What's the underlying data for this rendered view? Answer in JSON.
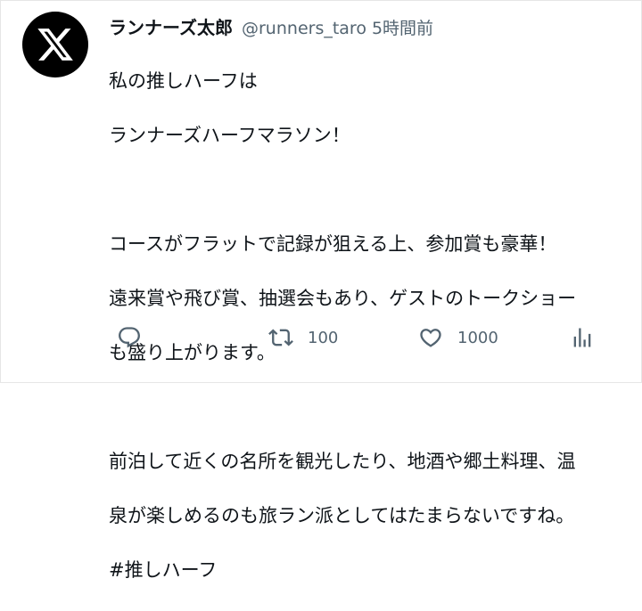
{
  "tweet": {
    "author_name": "ランナーズ太郎",
    "handle": "@runners_taro",
    "time": "5時間前",
    "lines": [
      "私の推しハーフは",
      "ランナーズハーフマラソン！",
      "",
      "コースがフラットで記録が狙える上、参加賞も豪華！",
      "遠来賞や飛び賞、抽選会もあり、ゲストのトークショー",
      "も盛り上がります。",
      "",
      "前泊して近くの名所を観光したり、地酒や郷土料理、温",
      "泉が楽しめるのも旅ラン派としてはたまらないですね。"
    ],
    "hashtag": "#推しハーフ"
  },
  "actions": {
    "retweet_count": "100",
    "like_count": "1000"
  },
  "icons": {
    "avatar": "x-logo-icon",
    "reply": "reply-icon",
    "retweet": "retweet-icon",
    "like": "heart-icon",
    "views": "views-icon"
  },
  "colors": {
    "text": "#0f1419",
    "muted": "#536471",
    "avatar_bg": "#000000"
  }
}
